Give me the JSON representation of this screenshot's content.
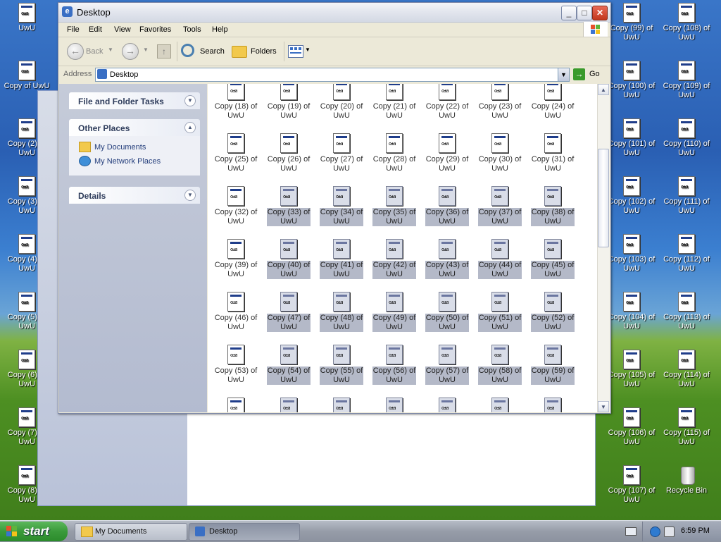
{
  "colors": {
    "accent": "#3a6fc4",
    "selection": "#b4b9c8",
    "taskpane": "#b3bbd0",
    "start": "#3a9a3a"
  },
  "desktop": {
    "left_icons": [
      "UwU",
      "Copy of UwU",
      "Copy (2) of UwU",
      "Copy (3) of UwU",
      "Copy (4) of UwU",
      "Copy (5) of UwU",
      "Copy (6) of UwU",
      "Copy (7) of UwU",
      "Copy (8) of UwU"
    ],
    "right_col1": [
      "Copy (99) of UwU",
      "Copy (100) of UwU",
      "Copy (101) of UwU",
      "Copy (102) of UwU",
      "Copy (103) of UwU",
      "Copy (104) of UwU",
      "Copy (105) of UwU",
      "Copy (106) of UwU",
      "Copy (107) of UwU"
    ],
    "right_col2": [
      "Copy (108) of UwU",
      "Copy (109) of UwU",
      "Copy (110) of UwU",
      "Copy (111) of UwU",
      "Copy (112) of UwU",
      "Copy (113) of UwU",
      "Copy (114) of UwU",
      "Copy (115) of UwU",
      "Recycle Bin"
    ]
  },
  "window": {
    "title": "Desktop",
    "menu": [
      "File",
      "Edit",
      "View",
      "Favorites",
      "Tools",
      "Help"
    ],
    "toolbar": {
      "back": "Back",
      "search": "Search",
      "folders": "Folders"
    },
    "address": {
      "label": "Address",
      "value": "Desktop",
      "go": "Go"
    }
  },
  "taskpane": {
    "file_tasks": "File and Folder Tasks",
    "other_places": "Other Places",
    "links": [
      "My Documents",
      "My Network Places"
    ],
    "details": "Details"
  },
  "files": {
    "rows": [
      [
        {
          "l1": "Copy (18) of",
          "l2": "UwU",
          "sel": false
        },
        {
          "l1": "Copy (19) of",
          "l2": "UwU",
          "sel": false
        },
        {
          "l1": "Copy (20) of",
          "l2": "UwU",
          "sel": false
        },
        {
          "l1": "Copy (21) of",
          "l2": "UwU",
          "sel": false
        },
        {
          "l1": "Copy (22) of",
          "l2": "UwU",
          "sel": false
        },
        {
          "l1": "Copy (23) of",
          "l2": "UwU",
          "sel": false
        },
        {
          "l1": "Copy (24) of",
          "l2": "UwU",
          "sel": false
        }
      ],
      [
        {
          "l1": "Copy (25) of",
          "l2": "UwU",
          "sel": false
        },
        {
          "l1": "Copy (26) of",
          "l2": "UwU",
          "sel": false
        },
        {
          "l1": "Copy (27) of",
          "l2": "UwU",
          "sel": false
        },
        {
          "l1": "Copy (28) of",
          "l2": "UwU",
          "sel": false
        },
        {
          "l1": "Copy (29) of",
          "l2": "UwU",
          "sel": false
        },
        {
          "l1": "Copy (30) of",
          "l2": "UwU",
          "sel": false
        },
        {
          "l1": "Copy (31) of",
          "l2": "UwU",
          "sel": false
        }
      ],
      [
        {
          "l1": "Copy (32) of",
          "l2": "UwU",
          "sel": false
        },
        {
          "l1": "Copy (33) of",
          "l2": "UwU",
          "sel": true
        },
        {
          "l1": "Copy (34) of",
          "l2": "UwU",
          "sel": true
        },
        {
          "l1": "Copy (35) of",
          "l2": "UwU",
          "sel": true
        },
        {
          "l1": "Copy (36) of",
          "l2": "UwU",
          "sel": true
        },
        {
          "l1": "Copy (37) of",
          "l2": "UwU",
          "sel": true
        },
        {
          "l1": "Copy (38) of",
          "l2": "UwU",
          "sel": true
        }
      ],
      [
        {
          "l1": "Copy (39) of",
          "l2": "UwU",
          "sel": false
        },
        {
          "l1": "Copy (40) of",
          "l2": "UwU",
          "sel": true
        },
        {
          "l1": "Copy (41) of",
          "l2": "UwU",
          "sel": true
        },
        {
          "l1": "Copy (42) of",
          "l2": "UwU",
          "sel": true
        },
        {
          "l1": "Copy (43) of",
          "l2": "UwU",
          "sel": true
        },
        {
          "l1": "Copy (44) of",
          "l2": "UwU",
          "sel": true
        },
        {
          "l1": "Copy (45) of",
          "l2": "UwU",
          "sel": true
        }
      ],
      [
        {
          "l1": "Copy (46) of",
          "l2": "UwU",
          "sel": false
        },
        {
          "l1": "Copy (47) of",
          "l2": "UwU",
          "sel": true
        },
        {
          "l1": "Copy (48) of",
          "l2": "UwU",
          "sel": true
        },
        {
          "l1": "Copy (49) of",
          "l2": "UwU",
          "sel": true
        },
        {
          "l1": "Copy (50) of",
          "l2": "UwU",
          "sel": true
        },
        {
          "l1": "Copy (51) of",
          "l2": "UwU",
          "sel": true
        },
        {
          "l1": "Copy (52) of",
          "l2": "UwU",
          "sel": true
        }
      ],
      [
        {
          "l1": "Copy (53) of",
          "l2": "UwU",
          "sel": false
        },
        {
          "l1": "Copy (54) of",
          "l2": "UwU",
          "sel": true
        },
        {
          "l1": "Copy (55) of",
          "l2": "UwU",
          "sel": true
        },
        {
          "l1": "Copy (56) of",
          "l2": "UwU",
          "sel": true
        },
        {
          "l1": "Copy (57) of",
          "l2": "UwU",
          "sel": true
        },
        {
          "l1": "Copy (58) of",
          "l2": "UwU",
          "sel": true
        },
        {
          "l1": "Copy (59) of",
          "l2": "UwU",
          "sel": true
        }
      ],
      [
        {
          "l1": "",
          "l2": "",
          "sel": false
        },
        {
          "l1": "",
          "l2": "",
          "sel": true
        },
        {
          "l1": "",
          "l2": "",
          "sel": true
        },
        {
          "l1": "",
          "l2": "",
          "sel": true
        },
        {
          "l1": "",
          "l2": "",
          "sel": true
        },
        {
          "l1": "",
          "l2": "",
          "sel": true
        },
        {
          "l1": "",
          "l2": "",
          "sel": true
        }
      ]
    ]
  },
  "taskbar": {
    "start": "start",
    "buttons": [
      "My Documents",
      "Desktop"
    ],
    "clock": "6:59 PM"
  }
}
